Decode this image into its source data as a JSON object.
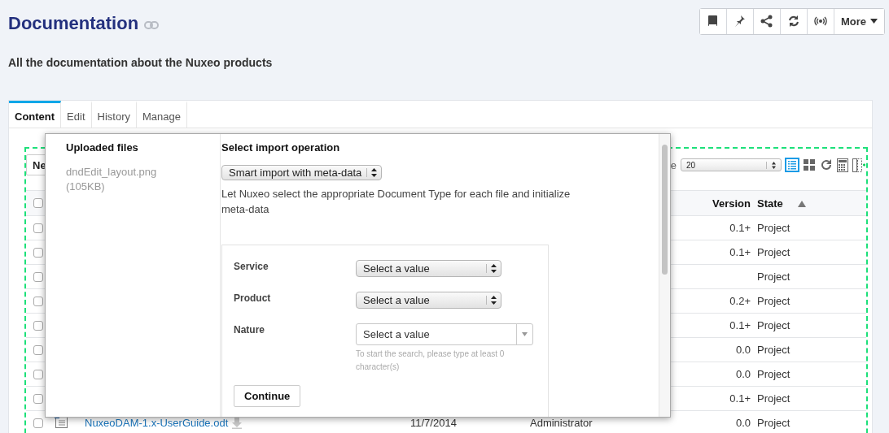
{
  "page": {
    "title": "Documentation",
    "description": "All the documentation about the Nuxeo products"
  },
  "actions": {
    "more_label": "More"
  },
  "tabs": [
    {
      "label": "Content",
      "selected": true
    },
    {
      "label": "Edit",
      "selected": false
    },
    {
      "label": "History",
      "selected": false
    },
    {
      "label": "Manage",
      "selected": false
    }
  ],
  "toolbar": {
    "new_button": "Ne",
    "page_size_label": "e",
    "page_size": "20",
    "views": [
      {
        "kind": "list",
        "selected": true
      },
      {
        "kind": "thumbnail",
        "selected": false
      }
    ]
  },
  "table": {
    "columns": [
      {
        "label": "Version",
        "sorted": false
      },
      {
        "label": "State",
        "sorted": true
      }
    ],
    "header_checked": false,
    "rows": [
      {
        "checked": false,
        "version": "0.1+",
        "state": "Project"
      },
      {
        "checked": false,
        "version": "0.1+",
        "state": "Project"
      },
      {
        "checked": false,
        "state": "Project"
      },
      {
        "checked": false,
        "version": "0.2+",
        "state": "Project"
      },
      {
        "checked": false,
        "version": "0.1+",
        "state": "Project"
      },
      {
        "checked": false,
        "version": "0.0",
        "state": "Project"
      },
      {
        "checked": false,
        "version": "0.0",
        "state": "Project"
      },
      {
        "checked": false,
        "version": "0.1+",
        "state": "Project"
      },
      {
        "checked": false,
        "title": "NuxeoDAM-1.x-UserGuide.odt",
        "date": "11/7/2014",
        "author": "Administrator",
        "version": "0.0",
        "state": "Project"
      }
    ]
  },
  "dialog": {
    "files_heading": "Uploaded files",
    "files": [
      {
        "name": "dndEdit_layout.png",
        "size": "(105KB)"
      }
    ],
    "operation_heading": "Select import operation",
    "operation": "Smart import with meta-data",
    "operation_description": "Let Nuxeo select the appropriate Document Type for each file and initialize meta-data",
    "fields": [
      {
        "label": "Service",
        "kind": "select",
        "value": "Select a value"
      },
      {
        "label": "Product",
        "kind": "select",
        "value": "Select a value"
      },
      {
        "label": "Nature",
        "kind": "combo",
        "value": "Select a value",
        "hint": "To start the search, please type at least 0 character(s)"
      }
    ],
    "continue_button": "Continue"
  }
}
